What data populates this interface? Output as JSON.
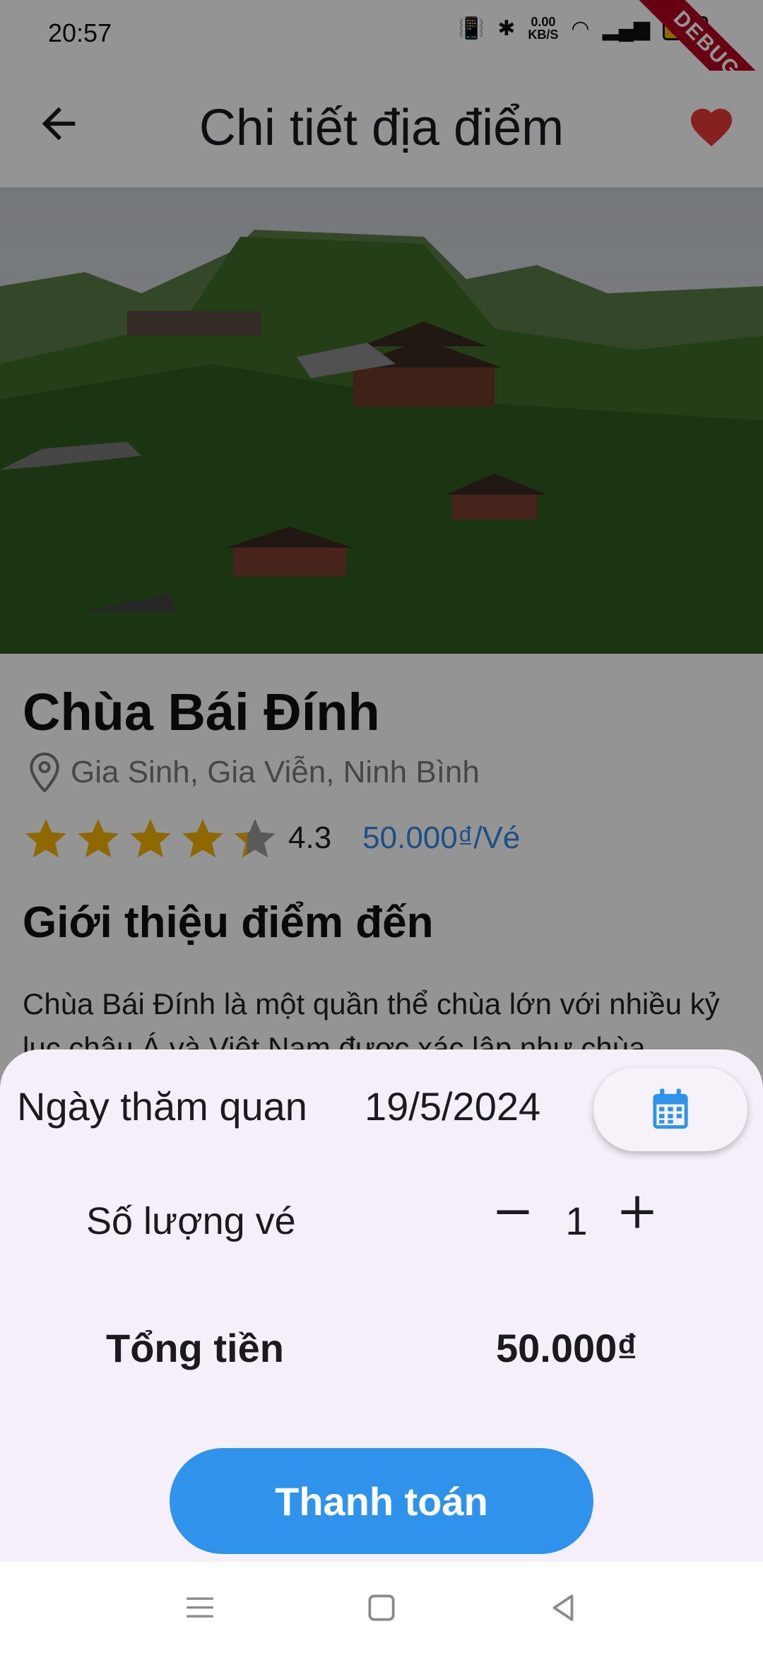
{
  "status_bar": {
    "time": "20:57",
    "net_speed_value": "0.00",
    "net_speed_unit": "KB/S",
    "battery": "100",
    "debug_banner": "DEBUG"
  },
  "app_bar": {
    "title": "Chi tiết địa điểm"
  },
  "place": {
    "name": "Chùa Bái Đính",
    "address": "Gia Sinh, Gia Viễn, Ninh Bình",
    "rating": "4.3",
    "rating_fraction": 0.86,
    "price": "50.000₫/Vé",
    "intro_title": "Giới thiệu điểm đến",
    "intro_text": "Chùa Bái Đính là một quần thể chùa lớn với nhiều kỷ lục châu Á và Việt Nam được xác lập như chùa"
  },
  "sheet": {
    "date_label": "Ngày thăm quan",
    "date_value": "19/5/2024",
    "quantity_label": "Số lượng vé",
    "quantity_value": "1",
    "total_label": "Tổng tiền",
    "total_value": "50.000₫",
    "pay_button": "Thanh toán"
  },
  "colors": {
    "accent": "#2f93ec",
    "price_text": "#2f8ae6",
    "heart": "#e53935",
    "star": "#f5b400",
    "sheet_bg": "#f4eff8"
  }
}
